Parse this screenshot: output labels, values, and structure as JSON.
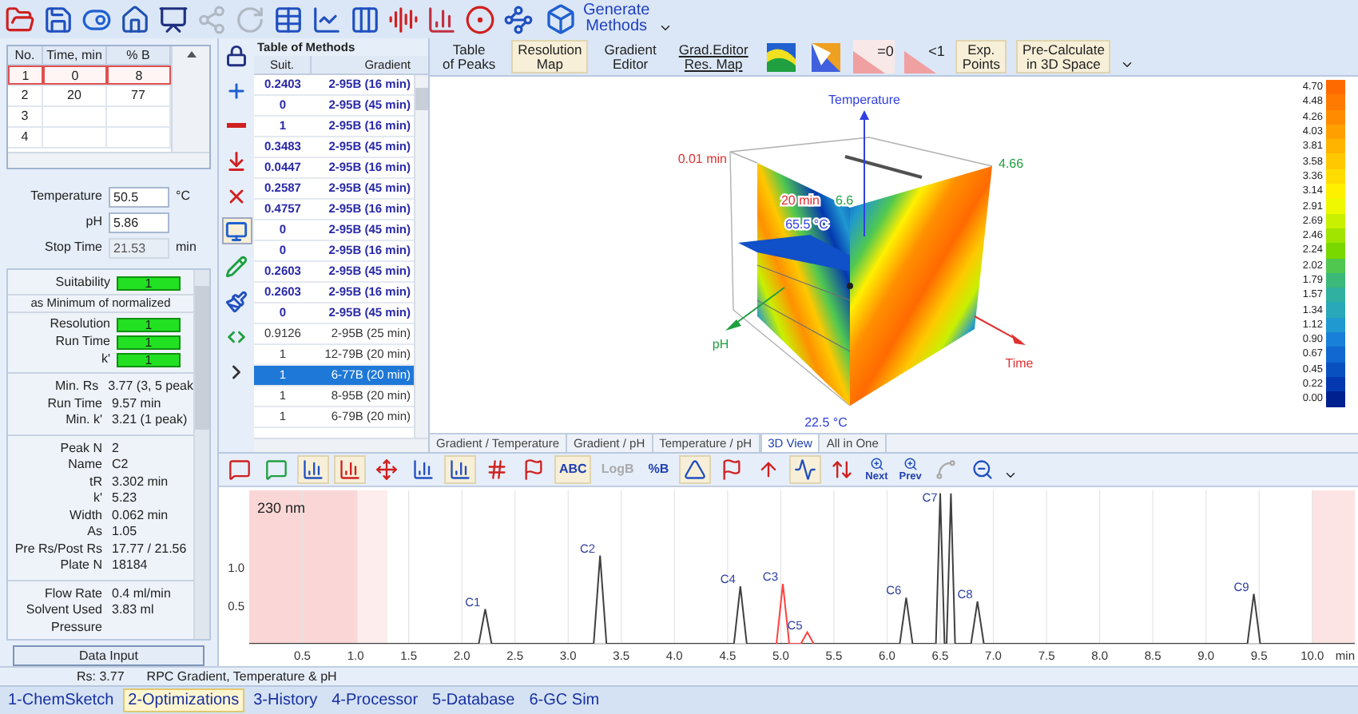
{
  "main_toolbar": {
    "items": [
      {
        "disabled": false
      },
      {
        "disabled": false
      },
      {
        "disabled": false
      },
      {
        "disabled": false
      },
      {
        "disabled": false
      },
      {
        "disabled": true
      },
      {
        "disabled": true
      },
      {
        "disabled": false
      },
      {
        "disabled": false
      },
      {
        "disabled": false
      },
      {
        "disabled": false
      },
      {
        "disabled": false
      },
      {
        "disabled": false
      },
      {
        "disabled": false
      }
    ],
    "generate_button": {
      "label": "Generate\nMethods"
    }
  },
  "gradient_table": {
    "columns": [
      "No.",
      "Time, min",
      "% B"
    ],
    "rows": [
      {
        "cells": [
          "1",
          "0",
          "8"
        ],
        "selected": true
      },
      {
        "cells": [
          "2",
          "20",
          "77"
        ],
        "selected": false
      },
      {
        "cells": [
          "3"
        ],
        "selected": false
      },
      {
        "cells": [
          "4"
        ],
        "selected": false
      }
    ]
  },
  "parameters": [
    {
      "label": "Temperature",
      "value": "50.5",
      "unit": "°C",
      "disabled": false
    },
    {
      "label": "pH",
      "value": "5.86",
      "disabled": false
    },
    {
      "label": "Stop Time",
      "value": "21.53",
      "unit": "min",
      "disabled": true
    }
  ],
  "results": {
    "suitability": {
      "label": "Suitability",
      "value": "1"
    },
    "criteria_note": "as Minimum of normalized",
    "criteria": [
      {
        "label": "Resolution",
        "value": "1"
      },
      {
        "label": "Run Time",
        "value": "1"
      },
      {
        "label": "k'",
        "value": "1"
      }
    ],
    "summary": [
      {
        "label": "Min. Rs",
        "value": "3.77 (3, 5 peak"
      },
      {
        "label": "Run Time",
        "value": "9.57 min"
      },
      {
        "label": "Min. k'",
        "value": "3.21 (1 peak)"
      }
    ],
    "peak_info": [
      {
        "label": "Peak N",
        "value": "2"
      },
      {
        "label": "Name",
        "value": "C2"
      },
      {
        "label": "tR",
        "value": "3.302 min"
      },
      {
        "label": "k'",
        "value": "5.23"
      },
      {
        "label": "Width",
        "value": "0.062 min"
      },
      {
        "label": "As",
        "value": "1.05"
      },
      {
        "label": "Pre Rs/Post Rs",
        "value": "17.77 / 21.56"
      },
      {
        "label": "Plate N",
        "value": "18184"
      }
    ],
    "system": [
      {
        "label": "Flow Rate",
        "value": "0.4 ml/min"
      },
      {
        "label": "Solvent Used",
        "value": "3.83 ml"
      },
      {
        "label": "Pressure"
      }
    ]
  },
  "data_input_button": "Data Input",
  "method_tools": [
    {
      "selected": false
    },
    {
      "selected": false
    },
    {
      "selected": false
    },
    {
      "selected": false
    },
    {
      "selected": false
    },
    {
      "selected": true
    },
    {
      "selected": false
    },
    {
      "selected": false
    },
    {
      "selected": false
    },
    {
      "selected": false
    }
  ],
  "methods_table": {
    "title": "Table of Methods",
    "columns": [
      "Suit.",
      "Gradient"
    ],
    "rows": [
      {
        "suit": "0.2403",
        "gradient": "2-95B (16 min)",
        "kind": "suggested",
        "selected": false
      },
      {
        "suit": "0",
        "gradient": "2-95B (45 min)",
        "kind": "suggested",
        "selected": false
      },
      {
        "suit": "1",
        "gradient": "2-95B (16 min)",
        "kind": "suggested",
        "selected": false
      },
      {
        "suit": "0.3483",
        "gradient": "2-95B (45 min)",
        "kind": "suggested",
        "selected": false
      },
      {
        "suit": "0.0447",
        "gradient": "2-95B (16 min)",
        "kind": "suggested",
        "selected": false
      },
      {
        "suit": "0.2587",
        "gradient": "2-95B (45 min)",
        "kind": "suggested",
        "selected": false
      },
      {
        "suit": "0.4757",
        "gradient": "2-95B (16 min)",
        "kind": "suggested",
        "selected": false
      },
      {
        "suit": "0",
        "gradient": "2-95B (45 min)",
        "kind": "suggested",
        "selected": false
      },
      {
        "suit": "0",
        "gradient": "2-95B (16 min)",
        "kind": "suggested",
        "selected": false
      },
      {
        "suit": "0.2603",
        "gradient": "2-95B (45 min)",
        "kind": "suggested",
        "selected": false
      },
      {
        "suit": "0.2603",
        "gradient": "2-95B (16 min)",
        "kind": "suggested",
        "selected": false
      },
      {
        "suit": "0",
        "gradient": "2-95B (45 min)",
        "kind": "suggested",
        "selected": false
      },
      {
        "suit": "0.9126",
        "gradient": "2-95B (25 min)",
        "kind": "plain",
        "selected": false
      },
      {
        "suit": "1",
        "gradient": "12-79B (20 min)",
        "kind": "plain",
        "selected": false
      },
      {
        "suit": "1",
        "gradient": "6-77B (20 min)",
        "kind": "plain",
        "selected": true
      },
      {
        "suit": "1",
        "gradient": "8-95B (20 min)",
        "kind": "plain",
        "selected": false
      },
      {
        "suit": "1",
        "gradient": "6-79B (20 min)",
        "kind": "plain",
        "selected": false
      }
    ]
  },
  "view_toolbar": [
    {
      "kind": "text",
      "label": "Table\nof Peaks",
      "selected": false
    },
    {
      "kind": "text",
      "label": "Resolution\nMap",
      "selected": true
    },
    {
      "kind": "text",
      "label": "Gradient\nEditor",
      "selected": false
    },
    {
      "kind": "split",
      "label": "Grad.Editor\nRes. Map",
      "selected": false
    },
    {
      "kind": "map",
      "selected": false
    },
    {
      "kind": "map",
      "selected": false
    },
    {
      "kind": "threshold",
      "label": "=0",
      "selected": true
    },
    {
      "kind": "threshold",
      "label": "<1",
      "selected": false
    },
    {
      "kind": "text",
      "label": "Exp.\nPoints",
      "selected": true
    },
    {
      "kind": "text",
      "label": "Pre-Calculate\nin 3D Space",
      "selected": true
    }
  ],
  "view_3d": {
    "labels": [
      {
        "text": "Temperature",
        "color": "#3040e0"
      },
      {
        "text": "0.01 min",
        "color": "#e03030"
      },
      {
        "text": "4.66",
        "color": "#20a040"
      },
      {
        "text": "pH",
        "color": "#20a040"
      },
      {
        "text": "Time",
        "color": "#e03030"
      },
      {
        "text": "22.5 °C",
        "color": "#3040e0"
      },
      {
        "text": "20 min",
        "color": "#e03030"
      },
      {
        "text": "6.6",
        "color": "#20a040"
      },
      {
        "text": "65.5 °C",
        "color": "#3040e0"
      }
    ],
    "legend": [
      {
        "label": "4.70",
        "color": "#ff6a00"
      },
      {
        "label": "4.48",
        "color": "#ff7a00"
      },
      {
        "label": "4.26",
        "color": "#ff8c00"
      },
      {
        "label": "4.03",
        "color": "#ffa000"
      },
      {
        "label": "3.81",
        "color": "#ffb400"
      },
      {
        "label": "3.58",
        "color": "#ffc800"
      },
      {
        "label": "3.36",
        "color": "#ffdc00"
      },
      {
        "label": "3.14",
        "color": "#fff000"
      },
      {
        "label": "2.91",
        "color": "#f0f800"
      },
      {
        "label": "2.69",
        "color": "#c8f000"
      },
      {
        "label": "2.46",
        "color": "#a0e400"
      },
      {
        "label": "2.24",
        "color": "#78d800"
      },
      {
        "label": "2.02",
        "color": "#50c850"
      },
      {
        "label": "1.79",
        "color": "#3cb878"
      },
      {
        "label": "1.57",
        "color": "#30b0a0"
      },
      {
        "label": "1.34",
        "color": "#28a8b8"
      },
      {
        "label": "1.12",
        "color": "#2098d0"
      },
      {
        "label": "0.90",
        "color": "#1880d8"
      },
      {
        "label": "0.67",
        "color": "#1068d0"
      },
      {
        "label": "0.45",
        "color": "#0850c0"
      },
      {
        "label": "0.22",
        "color": "#0438b0"
      },
      {
        "label": "0.00",
        "color": "#002090"
      }
    ]
  },
  "view_tabs": [
    {
      "label": "Gradient / Temperature",
      "selected": false
    },
    {
      "label": "Gradient / pH",
      "selected": false
    },
    {
      "label": "Temperature / pH",
      "selected": false
    },
    {
      "label": "3D View",
      "selected": true
    },
    {
      "label": "All in One",
      "selected": false
    }
  ],
  "chrom_toolbar": [
    {
      "kind": "icon",
      "selected": false,
      "disabled": false
    },
    {
      "kind": "icon",
      "selected": false,
      "disabled": false
    },
    {
      "kind": "icon",
      "selected": true,
      "disabled": false
    },
    {
      "kind": "icon",
      "selected": true,
      "disabled": false
    },
    {
      "kind": "icon",
      "selected": false,
      "disabled": false
    },
    {
      "kind": "icon",
      "selected": false,
      "disabled": false
    },
    {
      "kind": "icon",
      "selected": true,
      "disabled": false
    },
    {
      "kind": "icon",
      "selected": false,
      "disabled": false
    },
    {
      "kind": "icon",
      "selected": false,
      "disabled": false
    },
    {
      "kind": "text",
      "label": "ABC",
      "selected": true,
      "disabled": false
    },
    {
      "kind": "text",
      "label": "LogB",
      "selected": false,
      "disabled": true
    },
    {
      "kind": "text",
      "label": "%B",
      "selected": false,
      "disabled": false
    },
    {
      "kind": "icon",
      "selected": true,
      "disabled": false
    },
    {
      "kind": "icon",
      "selected": false,
      "disabled": false
    },
    {
      "kind": "icon",
      "selected": false,
      "disabled": false
    },
    {
      "kind": "icon",
      "selected": true,
      "disabled": false
    },
    {
      "kind": "icon",
      "selected": false,
      "disabled": false
    },
    {
      "kind": "labeled",
      "label": "Next",
      "selected": false,
      "disabled": false
    },
    {
      "kind": "labeled",
      "label": "Prev",
      "selected": false,
      "disabled": false
    },
    {
      "kind": "icon",
      "selected": false,
      "disabled": true
    },
    {
      "kind": "icon",
      "selected": false,
      "disabled": false
    }
  ],
  "chromatogram": {
    "channel_label": "230 nm",
    "chart_data": {
      "type": "line",
      "xlabel": "min",
      "x": [
        0,
        2.16,
        2.22,
        2.28,
        3.24,
        3.3,
        3.36,
        4.56,
        4.62,
        4.68,
        4.96,
        5.02,
        5.08,
        5.19,
        5.25,
        5.31,
        6.12,
        6.18,
        6.24,
        6.46,
        6.5,
        6.54,
        6.56,
        6.6,
        6.64,
        6.79,
        6.85,
        6.91,
        9.39,
        9.45,
        9.51,
        10.4
      ],
      "series": [
        {
          "color": "#404040",
          "values": [
            0,
            0,
            0.45,
            0,
            0,
            1.15,
            0,
            0,
            0.75,
            0,
            0,
            0,
            0,
            0,
            0,
            0,
            0,
            0.6,
            0,
            0,
            1.96,
            0,
            0,
            1.96,
            0,
            0,
            0.55,
            0,
            0,
            0.65,
            0,
            0
          ]
        },
        {
          "color": "#ff4040",
          "values": [
            null,
            null,
            null,
            null,
            null,
            null,
            null,
            null,
            null,
            null,
            0,
            0.78,
            0,
            0,
            0.15,
            0,
            null,
            null,
            null,
            null,
            null,
            null,
            null,
            null,
            null,
            null,
            null,
            null,
            null,
            null,
            null,
            null
          ]
        }
      ],
      "xlim": [
        0,
        10.4
      ],
      "ylim": [
        0,
        2
      ],
      "grid": true,
      "bands": [
        {
          "axis": "x",
          "from": 0,
          "to": 1.02,
          "color": "#fbd6d6"
        },
        {
          "axis": "x",
          "from": 1.02,
          "to": 1.3,
          "color": "#fdeded"
        },
        {
          "axis": "x",
          "from": 10,
          "to": 10.4,
          "color": "#fde4e4"
        }
      ],
      "xticks": [
        {
          "value": 0.5,
          "label": "0.5"
        },
        {
          "value": 1,
          "label": "1.0"
        },
        {
          "value": 1.5,
          "label": "1.5"
        },
        {
          "value": 2,
          "label": "2.0"
        },
        {
          "value": 2.5,
          "label": "2.5"
        },
        {
          "value": 3,
          "label": "3.0"
        },
        {
          "value": 3.5,
          "label": "3.5"
        },
        {
          "value": 4,
          "label": "4.0"
        },
        {
          "value": 4.5,
          "label": "4.5"
        },
        {
          "value": 5,
          "label": "5.0"
        },
        {
          "value": 5.5,
          "label": "5.5"
        },
        {
          "value": 6,
          "label": "6.0"
        },
        {
          "value": 6.5,
          "label": "6.5"
        },
        {
          "value": 7,
          "label": "7.0"
        },
        {
          "value": 7.5,
          "label": "7.5"
        },
        {
          "value": 8,
          "label": "8.0"
        },
        {
          "value": 8.5,
          "label": "8.5"
        },
        {
          "value": 9,
          "label": "9.0"
        },
        {
          "value": 9.5,
          "label": "9.5"
        },
        {
          "value": 10,
          "label": "10.0"
        }
      ],
      "yticks": [
        {
          "value": 0.5,
          "label": "0.5"
        },
        {
          "value": 1,
          "label": "1.0"
        }
      ],
      "annotations": [
        {
          "x": 2.22,
          "y": 0.45,
          "text": "C1"
        },
        {
          "x": 3.3,
          "y": 1.15,
          "text": "C2"
        },
        {
          "x": 4.62,
          "y": 0.75,
          "text": "C4"
        },
        {
          "x": 5.02,
          "y": 0.78,
          "text": "C3"
        },
        {
          "x": 5.25,
          "y": 0.15,
          "text": "C5"
        },
        {
          "x": 6.18,
          "y": 0.6,
          "text": "C6"
        },
        {
          "x": 6.52,
          "y": 1.95,
          "text": "C7"
        },
        {
          "x": 6.85,
          "y": 0.55,
          "text": "C8"
        },
        {
          "x": 9.45,
          "y": 0.65,
          "text": "C9"
        }
      ]
    }
  },
  "status_bar": [
    "Rs: 3.77",
    "RPC Gradient, Temperature & pH"
  ],
  "module_tabs": [
    {
      "label": "1-ChemSketch",
      "selected": false
    },
    {
      "label": "2-Optimizations",
      "selected": true
    },
    {
      "label": "3-History",
      "selected": false
    },
    {
      "label": "4-Processor",
      "selected": false
    },
    {
      "label": "5-Database",
      "selected": false
    },
    {
      "label": "6-GC Sim",
      "selected": false
    }
  ]
}
